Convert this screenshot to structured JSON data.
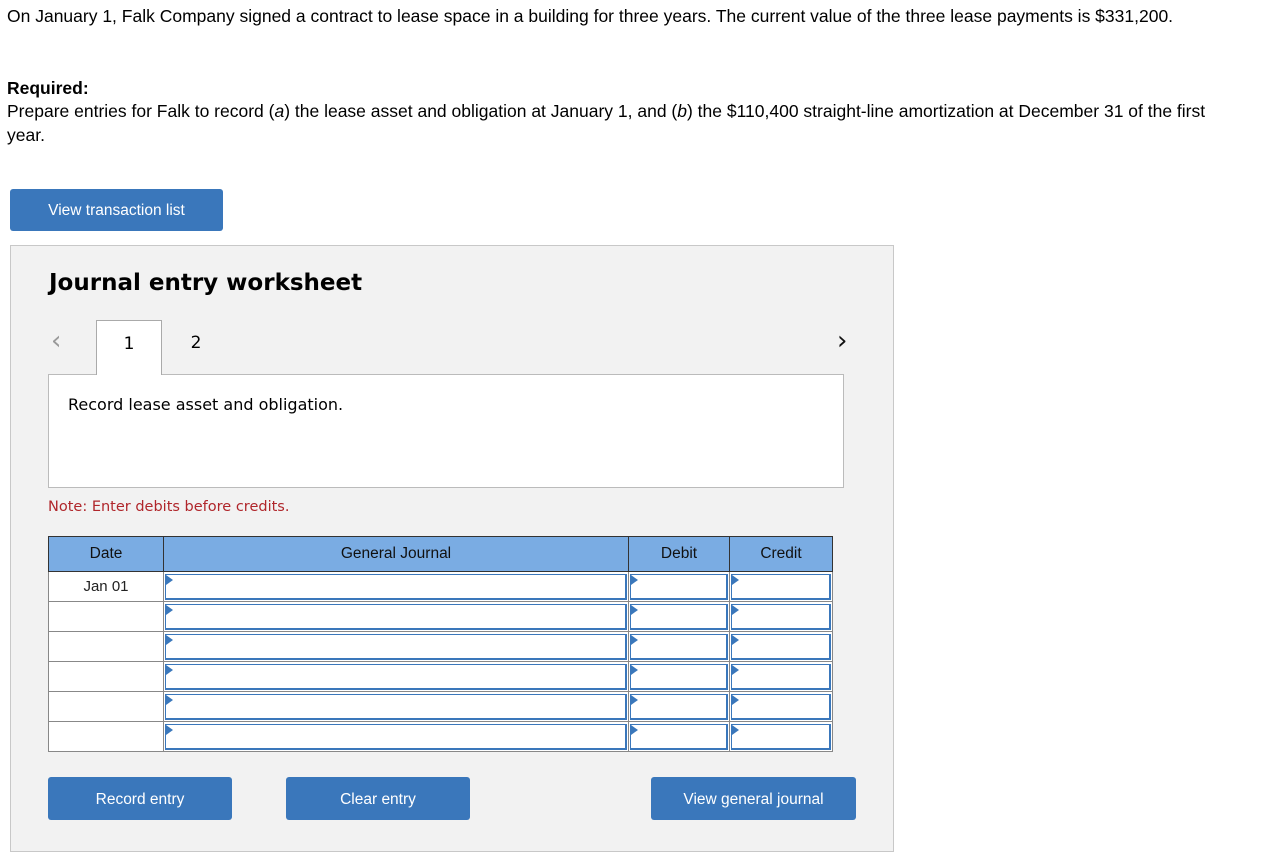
{
  "problem": {
    "intro": "On January 1, Falk Company signed a contract to lease space in a building for three years. The current value of the three lease payments is $331,200.",
    "required_label": "Required:",
    "required_text": "Prepare entries for Falk to record (a) the lease asset and obligation at January 1, and (b) the $110,400 straight-line amortization at December 31 of the first year."
  },
  "buttons": {
    "view_transaction_list": "View transaction list",
    "record_entry": "Record entry",
    "clear_entry": "Clear entry",
    "view_general_journal": "View general journal"
  },
  "worksheet": {
    "title": "Journal entry worksheet",
    "prev_icon": "‹",
    "next_icon": "›",
    "tabs": [
      {
        "label": "1",
        "active": true
      },
      {
        "label": "2",
        "active": false
      }
    ],
    "description": "Record lease asset and obligation.",
    "note": "Note: Enter debits before credits."
  },
  "journal": {
    "headers": [
      "Date",
      "General Journal",
      "Debit",
      "Credit"
    ],
    "rows": [
      {
        "date": "Jan 01",
        "account": "",
        "debit": "",
        "credit": ""
      },
      {
        "date": "",
        "account": "",
        "debit": "",
        "credit": ""
      },
      {
        "date": "",
        "account": "",
        "debit": "",
        "credit": ""
      },
      {
        "date": "",
        "account": "",
        "debit": "",
        "credit": ""
      },
      {
        "date": "",
        "account": "",
        "debit": "",
        "credit": ""
      },
      {
        "date": "",
        "account": "",
        "debit": "",
        "credit": ""
      }
    ]
  }
}
